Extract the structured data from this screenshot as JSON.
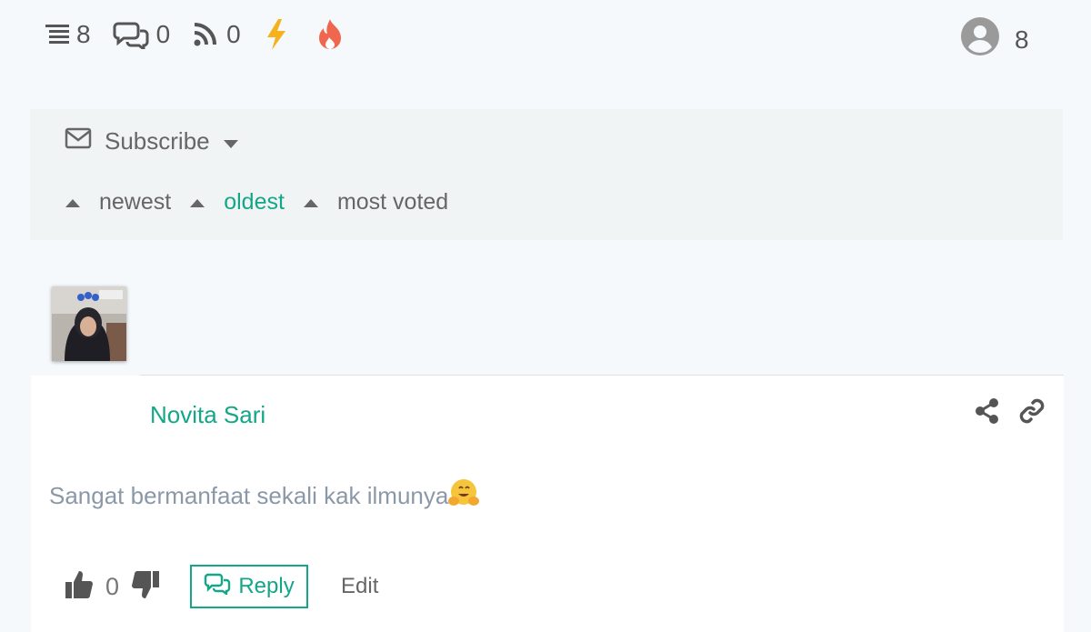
{
  "stats": {
    "threads": "8",
    "inline_comments": "0",
    "feeds": "0",
    "followers": "8"
  },
  "subscribe": {
    "label": "Subscribe"
  },
  "sort": {
    "newest": "newest",
    "oldest": "oldest",
    "most_voted": "most voted",
    "active": "oldest"
  },
  "comment": {
    "author": "Novita Sari",
    "text": "Sangat bermanfaat sekali kak ilmunya",
    "emoji": "hugging-face",
    "votes": "0",
    "reply_label": "Reply",
    "edit_label": "Edit"
  },
  "colors": {
    "accent": "#14a688",
    "lightning": "#f5b21c",
    "flame": "#f0674f"
  }
}
